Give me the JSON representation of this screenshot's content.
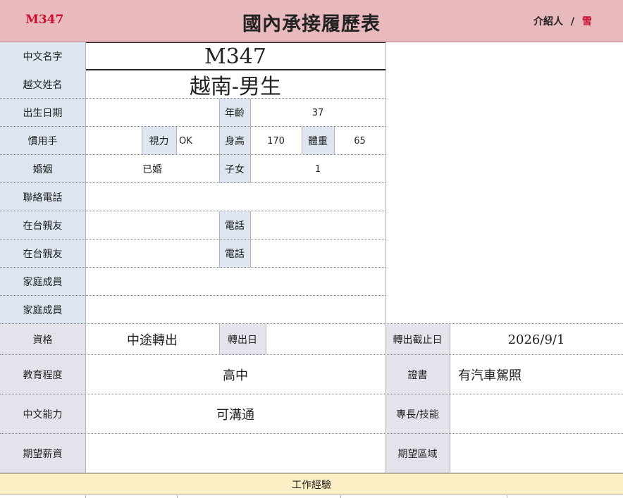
{
  "header": {
    "code": "M347",
    "title": "國內承接履歷表",
    "intro_label": "介紹人",
    "intro_sep": "/",
    "intro_name": "雪"
  },
  "form": {
    "chinese_name_label": "中文名字",
    "chinese_name_value": "M347",
    "viet_name_label": "越文姓名",
    "viet_name_value": "越南-男生",
    "birth_label": "出生日期",
    "birth_value": "",
    "age_label": "年齡",
    "age_value": "37",
    "hand_label": "慣用手",
    "hand_value": "",
    "vision_label": "視力",
    "vision_value": "OK",
    "height_label": "身高",
    "height_value": "170",
    "weight_label": "體重",
    "weight_value": "65",
    "marriage_label": "婚姻",
    "marriage_value": "已婚",
    "children_label": "子女",
    "children_value": "1",
    "contact_label": "聯絡電話",
    "contact_value": "",
    "relative1_label": "在台親友",
    "relative1_value": "",
    "relative1_phone_label": "電話",
    "relative1_phone_value": "",
    "relative2_label": "在台親友",
    "relative2_value": "",
    "relative2_phone_label": "電話",
    "relative2_phone_value": "",
    "family1_label": "家庭成員",
    "family1_value": "",
    "family2_label": "家庭成員",
    "family2_value": "",
    "qual_label": "資格",
    "qual_value": "中途轉出",
    "transfer_label": "轉出日",
    "transfer_value": "",
    "deadline_label": "轉出截止日",
    "deadline_value": "2026/9/1",
    "edu_label": "教育程度",
    "edu_value": "高中",
    "cert_label": "證書",
    "cert_value": "有汽車駕照",
    "lang_label": "中文能力",
    "lang_value": "可溝通",
    "skill_label": "專長/技能",
    "skill_value": "",
    "salary_label": "期望薪資",
    "salary_value": "",
    "area_label": "期望區域",
    "area_value": ""
  },
  "footer": {
    "work_label": "工作經驗"
  }
}
